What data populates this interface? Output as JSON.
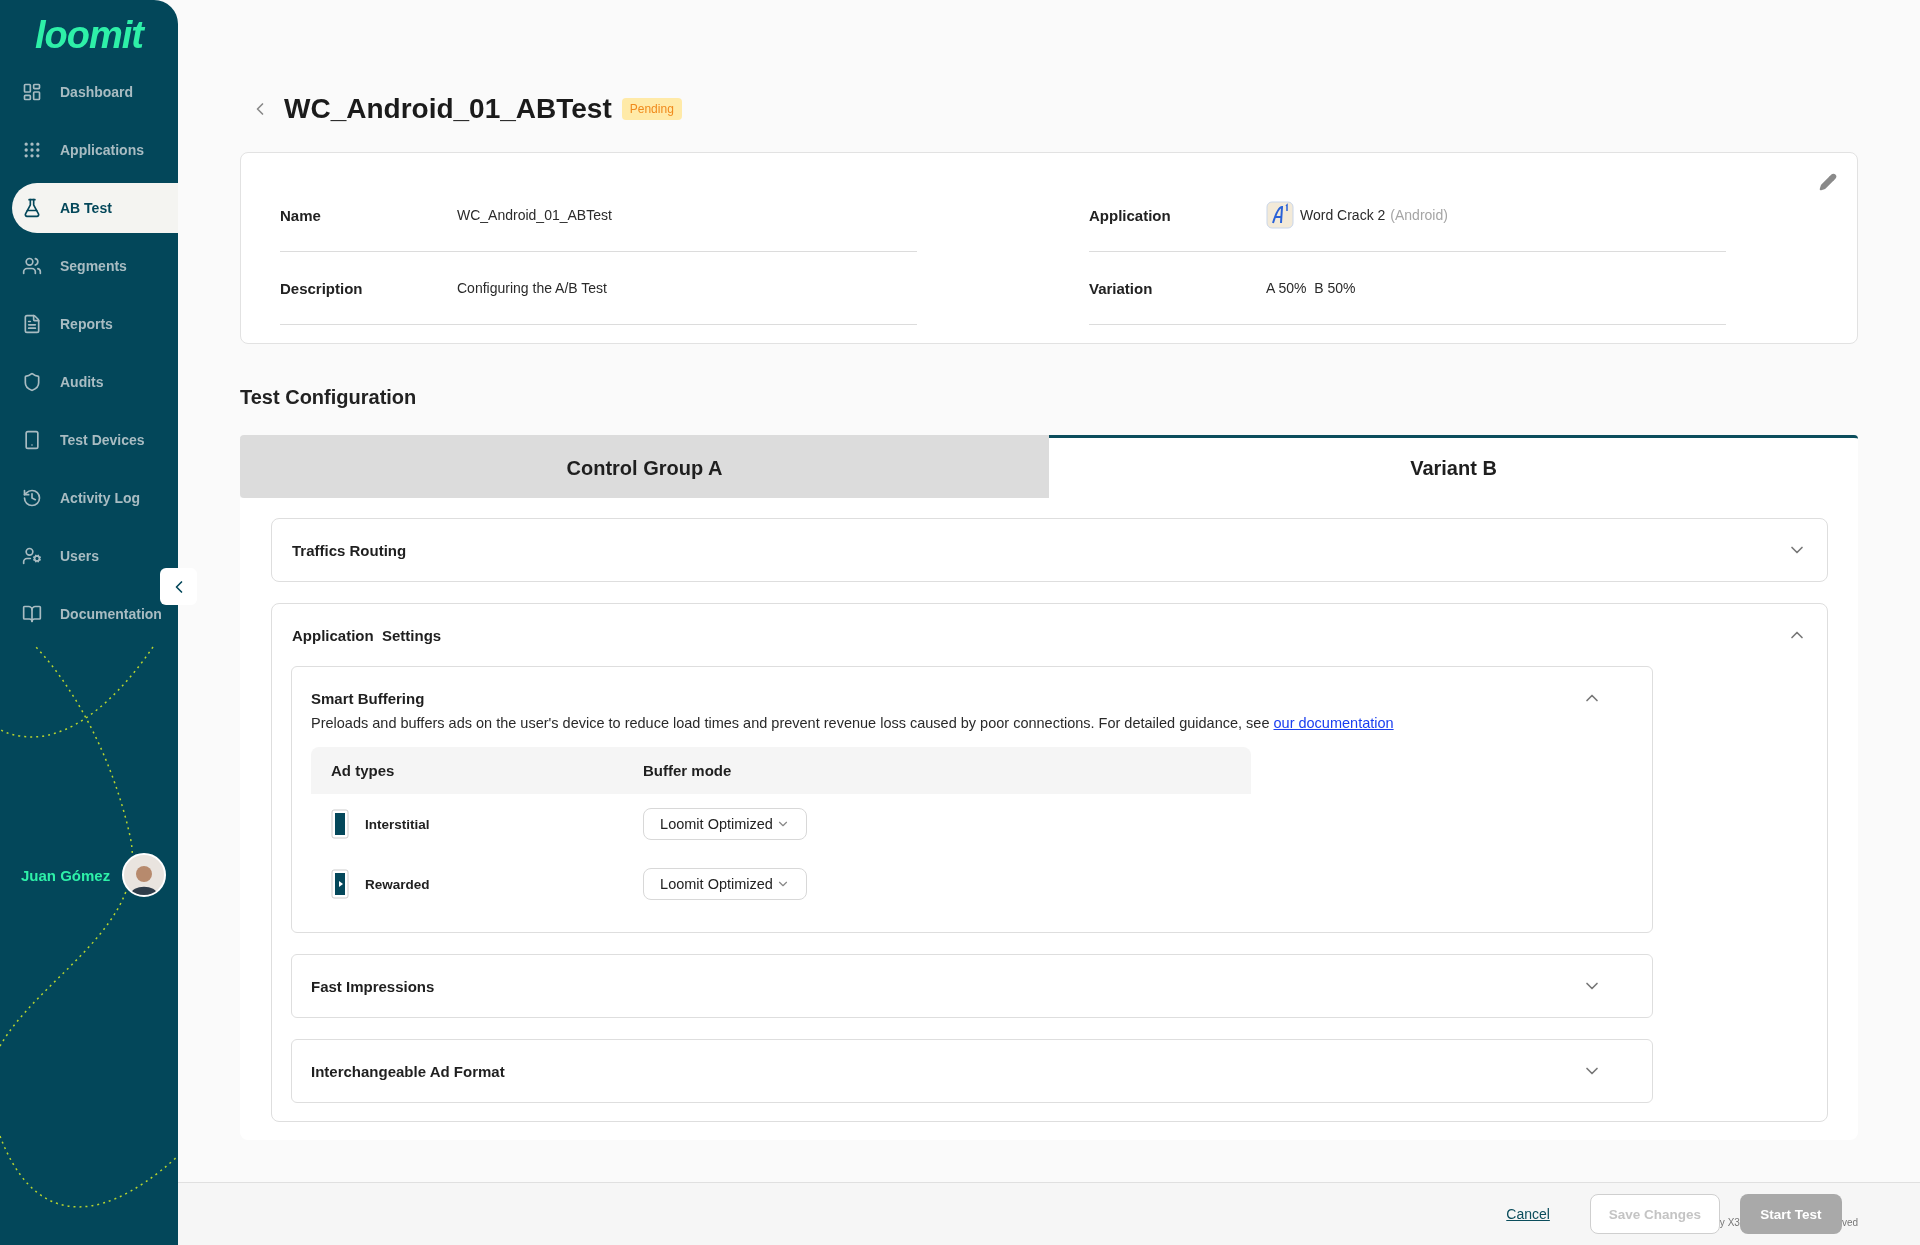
{
  "sidebar": {
    "logo": "loomit",
    "items": [
      {
        "label": "Dashboard",
        "selected": false
      },
      {
        "label": "Applications",
        "selected": false
      },
      {
        "label": "AB Test",
        "selected": true
      },
      {
        "label": "Segments",
        "selected": false
      },
      {
        "label": "Reports",
        "selected": false
      },
      {
        "label": "Audits",
        "selected": false
      },
      {
        "label": "Test Devices",
        "selected": false
      },
      {
        "label": "Activity Log",
        "selected": false
      },
      {
        "label": "Users",
        "selected": false
      },
      {
        "label": "Documentation",
        "selected": false
      }
    ],
    "user": {
      "name": "Juan Gómez"
    }
  },
  "header": {
    "title": "WC_Android_01_ABTest",
    "status": "Pending"
  },
  "details": [
    {
      "kind": "text",
      "label": "Name",
      "value": "WC_Android_01_ABTest"
    },
    {
      "kind": "app",
      "label": "Application",
      "value": "Word Crack 2",
      "platform": "(Android)"
    },
    {
      "kind": "text",
      "label": "Description",
      "value": "Configuring the A/B Test"
    },
    {
      "kind": "text",
      "label": "Variation",
      "value": "A 50%  B 50%"
    }
  ],
  "section_title": "Test Configuration",
  "tabs": [
    {
      "label": "Control Group A",
      "selected": false
    },
    {
      "label": "Variant B",
      "selected": true
    }
  ],
  "panels": [
    {
      "title": "Traffics Routing",
      "expanded": false
    },
    {
      "title": "Application  Settings",
      "expanded": true,
      "subpanels": [
        {
          "title": "Smart Buffering",
          "expanded": true,
          "description": "Preloads and buffers ads on the user's device to reduce load times and prevent revenue loss caused by poor connections. For detailed guidance, see",
          "link": "our documentation",
          "table": {
            "columns": [
              "Ad types",
              "Buffer mode"
            ],
            "rows": [
              {
                "kind": "interstitial",
                "ad_type": "Interstitial",
                "buffer_mode": "Loomit Optimized"
              },
              {
                "kind": "rewarded",
                "ad_type": "Rewarded",
                "buffer_mode": "Loomit Optimized"
              }
            ]
          }
        },
        {
          "title": "Fast Impressions",
          "expanded": false
        },
        {
          "title": "Interchangeable Ad Format",
          "expanded": false
        }
      ]
    }
  ],
  "footer": {
    "cancel": "Cancel",
    "save": {
      "label": "Save Changes",
      "disabled": true
    },
    "start": {
      "label": "Start Test",
      "disabled": true
    },
    "fragment_left": "y X3",
    "fragment_right": "ved"
  }
}
